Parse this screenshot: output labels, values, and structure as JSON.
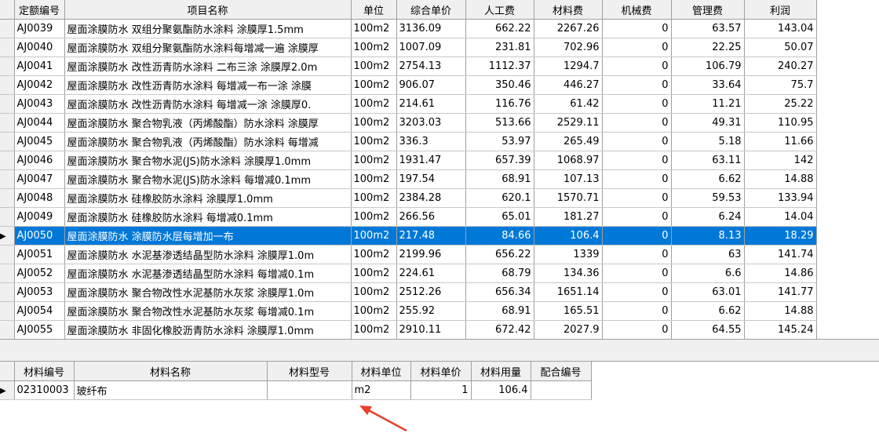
{
  "main_table": {
    "headers": [
      "定额编号",
      "项目名称",
      "单位",
      "综合单价",
      "人工费",
      "材料费",
      "机械费",
      "管理费",
      "利润"
    ],
    "rows": [
      [
        "AJ0039",
        "屋面涂膜防水 双组分聚氨酯防水涂料 涂膜厚1.5mm",
        "100m2",
        "3136.09",
        "662.22",
        "2267.26",
        "0",
        "63.57",
        "143.04"
      ],
      [
        "AJ0040",
        "屋面涂膜防水 双组分聚氨酯防水涂料每增减一遍 涂膜厚",
        "100m2",
        "1007.09",
        "231.81",
        "702.96",
        "0",
        "22.25",
        "50.07"
      ],
      [
        "AJ0041",
        "屋面涂膜防水 改性沥青防水涂料 二布三涂 涂膜厚2.0m",
        "100m2",
        "2754.13",
        "1112.37",
        "1294.7",
        "0",
        "106.79",
        "240.27"
      ],
      [
        "AJ0042",
        "屋面涂膜防水 改性沥青防水涂料 每增减一布一涂 涂膜",
        "100m2",
        "906.07",
        "350.46",
        "446.27",
        "0",
        "33.64",
        "75.7"
      ],
      [
        "AJ0043",
        "屋面涂膜防水 改性沥青防水涂料 每增减一涂 涂膜厚0.",
        "100m2",
        "214.61",
        "116.76",
        "61.42",
        "0",
        "11.21",
        "25.22"
      ],
      [
        "AJ0044",
        "屋面涂膜防水 聚合物乳液（丙烯酸酯）防水涂料 涂膜厚",
        "100m2",
        "3203.03",
        "513.66",
        "2529.11",
        "0",
        "49.31",
        "110.95"
      ],
      [
        "AJ0045",
        "屋面涂膜防水 聚合物乳液（丙烯酸酯）防水涂料 每增减",
        "100m2",
        "336.3",
        "53.97",
        "265.49",
        "0",
        "5.18",
        "11.66"
      ],
      [
        "AJ0046",
        "屋面涂膜防水 聚合物水泥(JS)防水涂料 涂膜厚1.0mm",
        "100m2",
        "1931.47",
        "657.39",
        "1068.97",
        "0",
        "63.11",
        "142"
      ],
      [
        "AJ0047",
        "屋面涂膜防水 聚合物水泥(JS)防水涂料 每增减0.1mm",
        "100m2",
        "197.54",
        "68.91",
        "107.13",
        "0",
        "6.62",
        "14.88"
      ],
      [
        "AJ0048",
        "屋面涂膜防水 硅橡胶防水涂料 涂膜厚1.0mm",
        "100m2",
        "2384.28",
        "620.1",
        "1570.71",
        "0",
        "59.53",
        "133.94"
      ],
      [
        "AJ0049",
        "屋面涂膜防水 硅橡胶防水涂料 每增减0.1mm",
        "100m2",
        "266.56",
        "65.01",
        "181.27",
        "0",
        "6.24",
        "14.04"
      ],
      [
        "AJ0050",
        "屋面涂膜防水 涂膜防水层每增加一布",
        "100m2",
        "217.48",
        "84.66",
        "106.4",
        "0",
        "8.13",
        "18.29"
      ],
      [
        "AJ0051",
        "屋面涂膜防水 水泥基渗透结晶型防水涂料 涂膜厚1.0m",
        "100m2",
        "2199.96",
        "656.22",
        "1339",
        "0",
        "63",
        "141.74"
      ],
      [
        "AJ0052",
        "屋面涂膜防水 水泥基渗透结晶型防水涂料 每增减0.1m",
        "100m2",
        "224.61",
        "68.79",
        "134.36",
        "0",
        "6.6",
        "14.86"
      ],
      [
        "AJ0053",
        "屋面涂膜防水 聚合物改性水泥基防水灰浆 涂膜厚1.0m",
        "100m2",
        "2512.26",
        "656.34",
        "1651.14",
        "0",
        "63.01",
        "141.77"
      ],
      [
        "AJ0054",
        "屋面涂膜防水 聚合物改性水泥基防水灰浆 每增减0.1m",
        "100m2",
        "255.92",
        "68.91",
        "165.51",
        "0",
        "6.62",
        "14.88"
      ],
      [
        "AJ0055",
        "屋面涂膜防水 非固化橡胶沥青防水涂料 涂膜厚1.0mm",
        "100m2",
        "2910.11",
        "672.42",
        "2027.9",
        "0",
        "64.55",
        "145.24"
      ]
    ],
    "selected_row": 11
  },
  "detail_table": {
    "headers": [
      "材料编号",
      "材料名称",
      "材料型号",
      "材料单位",
      "材料单价",
      "材料用量",
      "配合编号"
    ],
    "rows": [
      [
        "02310003",
        "玻纤布",
        "",
        "m2",
        "1",
        "106.4",
        ""
      ]
    ]
  },
  "colors": {
    "selection": "#0078d7",
    "annotation_arrow": "#e8402a"
  }
}
